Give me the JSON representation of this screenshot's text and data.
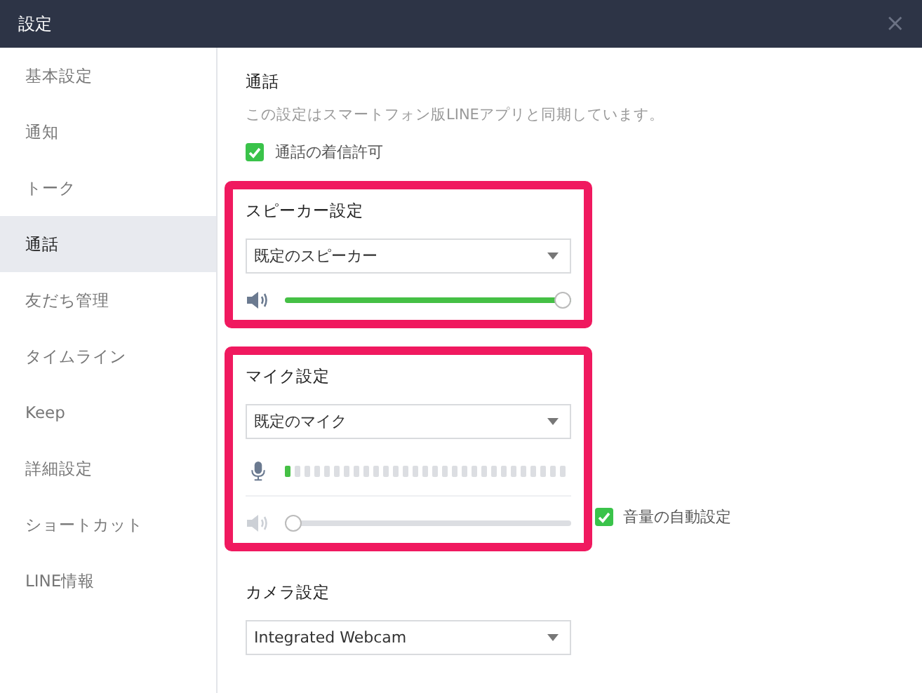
{
  "window": {
    "title": "設定",
    "close": "×"
  },
  "sidebar": {
    "items": [
      {
        "label": "基本設定",
        "selected": false
      },
      {
        "label": "通知",
        "selected": false
      },
      {
        "label": "トーク",
        "selected": false
      },
      {
        "label": "通話",
        "selected": true
      },
      {
        "label": "友だち管理",
        "selected": false
      },
      {
        "label": "タイムライン",
        "selected": false
      },
      {
        "label": "Keep",
        "selected": false
      },
      {
        "label": "詳細設定",
        "selected": false
      },
      {
        "label": "ショートカット",
        "selected": false
      },
      {
        "label": "LINE情報",
        "selected": false
      }
    ]
  },
  "call": {
    "heading": "通話",
    "description": "この設定はスマートフォン版LINEアプリと同期しています。",
    "allow_incoming": {
      "label": "通話の着信許可",
      "checked": true
    }
  },
  "speaker": {
    "heading": "スピーカー設定",
    "highlighted": true,
    "device": "既定のスピーカー",
    "volume": {
      "level": 1.0,
      "disabled": false
    }
  },
  "mic": {
    "heading": "マイク設定",
    "highlighted": true,
    "device": "既定のマイク",
    "input_meter": {
      "level": 0.04
    },
    "volume": {
      "level": 0.0,
      "disabled": true
    },
    "auto_volume": {
      "label": "音量の自動設定",
      "checked": true
    }
  },
  "camera": {
    "heading": "カメラ設定",
    "device": "Integrated Webcam"
  }
}
